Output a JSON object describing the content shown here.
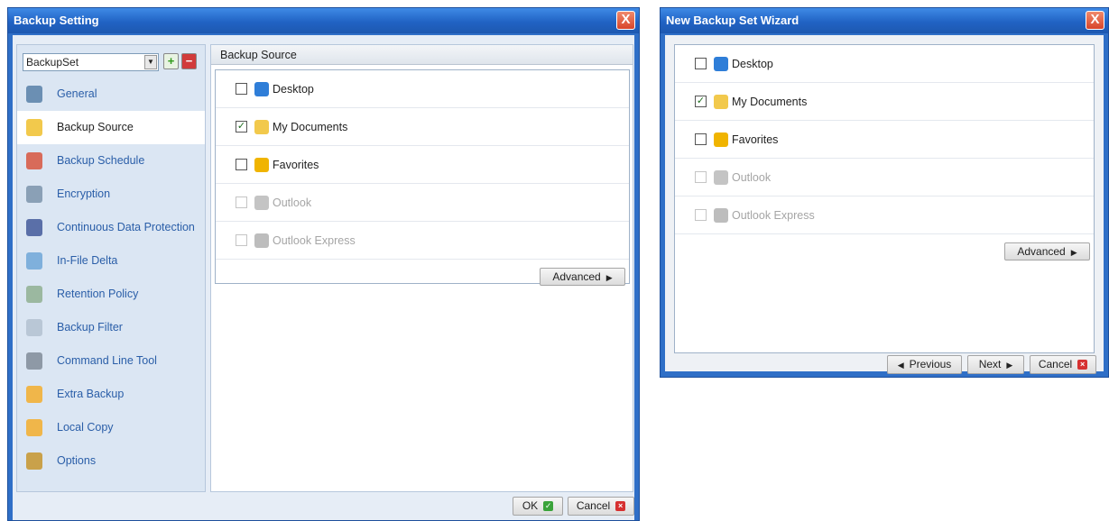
{
  "backup_setting": {
    "title": "Backup Setting",
    "close": "X",
    "backupset_value": "BackupSet",
    "add_symbol": "+",
    "remove_symbol": "−",
    "nav_items": [
      {
        "label": "General",
        "icon": "general-icon",
        "color": "#6b8fb3"
      },
      {
        "label": "Backup Source",
        "icon": "folder-icon",
        "color": "#f2c94c"
      },
      {
        "label": "Backup Schedule",
        "icon": "schedule-icon",
        "color": "#d86b5a"
      },
      {
        "label": "Encryption",
        "icon": "lock-icon",
        "color": "#8aa0b6"
      },
      {
        "label": "Continuous Data Protection",
        "icon": "shield-icon",
        "color": "#5a6fa8"
      },
      {
        "label": "In-File Delta",
        "icon": "document-icon",
        "color": "#7fb0dc"
      },
      {
        "label": "Retention Policy",
        "icon": "recycle-bin-icon",
        "color": "#9bb8a0"
      },
      {
        "label": "Backup Filter",
        "icon": "filter-icon",
        "color": "#b9c7d6"
      },
      {
        "label": "Command Line Tool",
        "icon": "terminal-icon",
        "color": "#8e99a6"
      },
      {
        "label": "Extra Backup",
        "icon": "extra-backup-icon",
        "color": "#f0b64a"
      },
      {
        "label": "Local Copy",
        "icon": "local-copy-icon",
        "color": "#f0b64a"
      },
      {
        "label": "Options",
        "icon": "options-icon",
        "color": "#c9a14a"
      }
    ],
    "active_index": 1,
    "pane_title": "Backup Source",
    "sources": [
      {
        "label": "Desktop",
        "checked": false,
        "disabled": false,
        "icon": "desktop-icon",
        "color": "#2f7ed8"
      },
      {
        "label": "My Documents",
        "checked": true,
        "disabled": false,
        "icon": "my-documents-icon",
        "color": "#f2c94c"
      },
      {
        "label": "Favorites",
        "checked": false,
        "disabled": false,
        "icon": "star-icon",
        "color": "#f0b400"
      },
      {
        "label": "Outlook",
        "checked": false,
        "disabled": true,
        "icon": "outlook-icon",
        "color": "#c4c4c4"
      },
      {
        "label": "Outlook Express",
        "checked": false,
        "disabled": true,
        "icon": "outlook-express-icon",
        "color": "#bdbdbd"
      }
    ],
    "advanced_label": "Advanced",
    "ok_label": "OK",
    "cancel_label": "Cancel"
  },
  "wizard": {
    "title": "New Backup Set Wizard",
    "close": "X",
    "sources": [
      {
        "label": "Desktop",
        "checked": false,
        "disabled": false,
        "icon": "desktop-icon",
        "color": "#2f7ed8"
      },
      {
        "label": "My Documents",
        "checked": true,
        "disabled": false,
        "icon": "my-documents-icon",
        "color": "#f2c94c"
      },
      {
        "label": "Favorites",
        "checked": false,
        "disabled": false,
        "icon": "star-icon",
        "color": "#f0b400"
      },
      {
        "label": "Outlook",
        "checked": false,
        "disabled": true,
        "icon": "outlook-icon",
        "color": "#c4c4c4"
      },
      {
        "label": "Outlook Express",
        "checked": false,
        "disabled": true,
        "icon": "outlook-express-icon",
        "color": "#bdbdbd"
      }
    ],
    "advanced_label": "Advanced",
    "previous_label": "Previous",
    "next_label": "Next",
    "cancel_label": "Cancel"
  }
}
